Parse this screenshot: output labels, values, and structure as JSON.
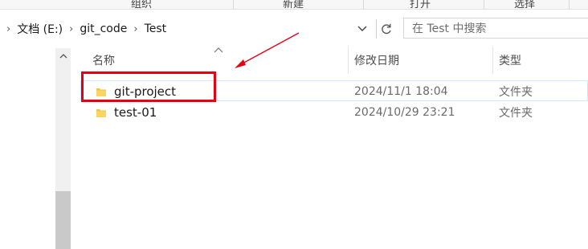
{
  "ribbon": {
    "groups": [
      "组织",
      "新建",
      "打开",
      "选择"
    ]
  },
  "breadcrumb": {
    "items": [
      "文档 (E:)",
      "git_code",
      "Test"
    ]
  },
  "search": {
    "placeholder": "在 Test 中搜索"
  },
  "columns": {
    "name": "名称",
    "date": "修改日期",
    "type": "类型"
  },
  "files": [
    {
      "name": "git-project",
      "date": "2024/11/1 18:04",
      "type": "文件夹"
    },
    {
      "name": "test-01",
      "date": "2024/10/29 23:21",
      "type": "文件夹"
    }
  ],
  "colors": {
    "annotation_red": "#e60012",
    "folder_yellow": "#f5c242",
    "selection_border": "#cde8ff"
  },
  "icons": {
    "folder": "folder-icon",
    "refresh": "refresh-icon",
    "dropdown": "chevron-down-icon",
    "breadcrumb_separator": "chevron-right-icon"
  }
}
